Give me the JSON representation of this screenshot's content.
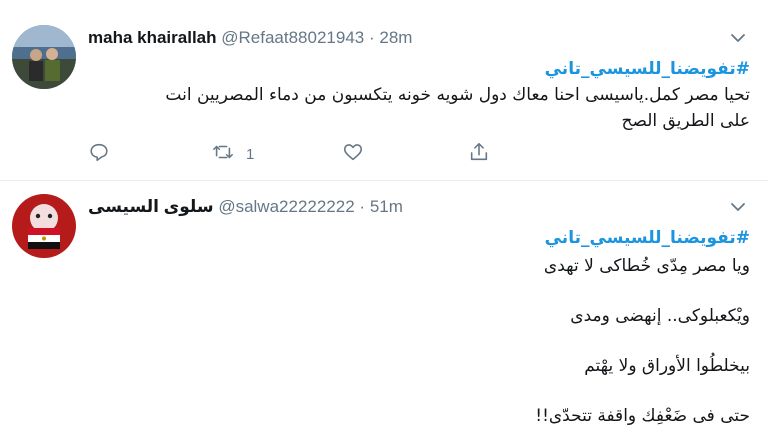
{
  "tweets": [
    {
      "name": "maha khairallah",
      "handle": "@Refaat88021943",
      "separator": "·",
      "time": "28m",
      "hashtag": "#تفويضنا_للسيسي_تاني",
      "lines": [
        "تحيا مصر كمل.ياسيسى احنا معاك دول شويه خونه يتكسبون من دماء المصريين انت",
        "على الطريق الصح"
      ],
      "actions": {
        "reply_icon": "reply-icon",
        "retweet_icon": "retweet-icon",
        "retweet_count": "1",
        "like_icon": "heart-icon",
        "share_icon": "share-icon"
      }
    },
    {
      "name": "سلوى السيسى",
      "handle": "@salwa22222222",
      "separator": "·",
      "time": "51m",
      "hashtag": "#تفويضنا_للسيسي_تاني",
      "lines": [
        "ويا مصر مِدّى خُطاكى لا تهدى",
        "ويْكعبلوكى.. إنهضى ومدى",
        "بيخلطُوا الأوراق ولا يهْتم",
        "حتى فى ضَعْفِك واقفة تتحدّى!!"
      ]
    }
  ],
  "colors": {
    "hashtag": "#1b95e0",
    "secondary_text": "#657786",
    "divider": "#e6ecf0"
  }
}
